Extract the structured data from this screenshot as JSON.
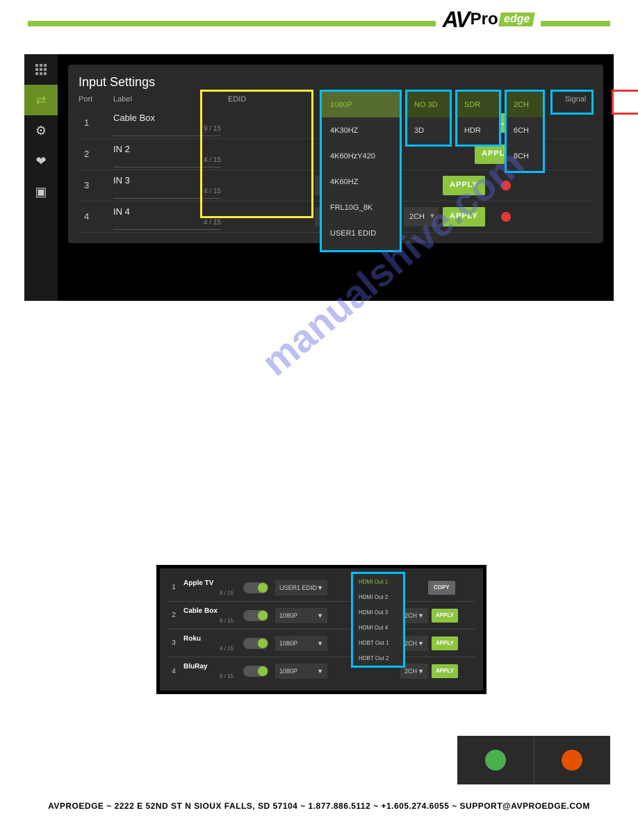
{
  "logo": {
    "av": "AV",
    "pro": "Pro",
    "edge": "edge"
  },
  "sidebar": {
    "icons": [
      "grid",
      "swap",
      "gear",
      "heart",
      "terminal"
    ]
  },
  "input_settings": {
    "title": "Input Settings",
    "headers": {
      "port": "Port",
      "label": "Label",
      "edid": "EDID",
      "signal": "Signal"
    },
    "rows": [
      {
        "port": "1",
        "label": "Cable Box",
        "count": "9 / 15",
        "apply": "APPLY",
        "signal": "green"
      },
      {
        "port": "2",
        "label": "IN 2",
        "count": "4 / 15",
        "apply": "APPLY",
        "signal": "green"
      },
      {
        "port": "3",
        "label": "IN 3",
        "count": "4 / 15",
        "d3d": "NO 3D",
        "dhdr": "SDR",
        "apply": "APPLY",
        "signal": "red"
      },
      {
        "port": "4",
        "label": "IN 4",
        "count": "4 / 15",
        "d3d": "NO 3D",
        "dhdr": "SDR",
        "dch": "2CH",
        "apply": "APPLY",
        "signal": "red"
      }
    ],
    "edid_options": [
      "1080P",
      "4K30HZ",
      "4K60HzY420",
      "4K60HZ",
      "FRL10G_8K",
      "USER1 EDID"
    ],
    "d3d_options": [
      "NO 3D",
      "3D"
    ],
    "hdr_options": [
      "SDR",
      "HDR"
    ],
    "ch_options": [
      "2CH",
      "6CH",
      "8CH"
    ]
  },
  "copy_settings": {
    "rows": [
      {
        "port": "1",
        "label": "Apple TV",
        "count": "8 / 15",
        "edid": "USER1 EDID",
        "btn": "COPY"
      },
      {
        "port": "2",
        "label": "Cable Box",
        "count": "9 / 15",
        "edid": "1080P",
        "ch": "2CH",
        "btn": "APPLY"
      },
      {
        "port": "3",
        "label": "Roku",
        "count": "4 / 15",
        "edid": "1080P",
        "ch": "2CH",
        "btn": "APPLY"
      },
      {
        "port": "4",
        "label": "BluRay",
        "count": "6 / 15",
        "edid": "1080P",
        "ch": "2CH",
        "btn": "APPLY"
      }
    ],
    "out_options": [
      "HDMI Out 1",
      "HDMI Out 2",
      "HDMI Out 3",
      "HDMI Out 4",
      "HDBT Out 1",
      "HDBT Out 2"
    ]
  },
  "watermark": "manualshive.com",
  "footer": "AVPROEDGE  ~  2222 E 52ND ST N SIOUX FALLS, SD 57104  ~  1.877.886.5112  ~  +1.605.274.6055  ~  SUPPORT@AVPROEDGE.COM"
}
